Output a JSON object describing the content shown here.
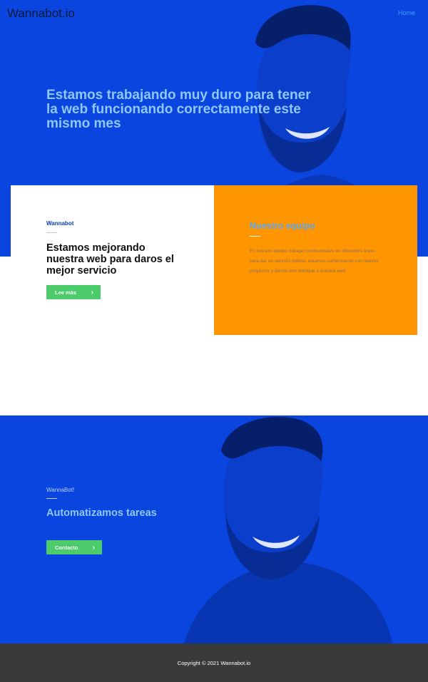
{
  "header": {
    "brand": "Wannabot.io",
    "menu_link": "Home"
  },
  "hero": {
    "title": "Estamos trabajando muy duro para tener la web funcionando correctamente este mismo mes"
  },
  "intro_card": {
    "kicker": "Wannabot",
    "heading": "Estamos mejorando nuestra web para daros el mejor servicio",
    "button_label": "Lee más"
  },
  "team_card": {
    "title": "Nuestro equipo",
    "text": "En nuestro equipo trabajan profesionales en diferentes áreas para dar un servicio óptimo, estamos comenzando con nuevos proyectos y dando otro enfoque a nuestra web."
  },
  "cta": {
    "kicker": "WannaBot!",
    "title": "Automatizamos tareas",
    "button_label": "Contacto"
  },
  "footer": {
    "copyright": "Copyright © 2021 Wannabot.io"
  },
  "colors": {
    "brand_blue": "#0a45e0",
    "orange": "#ff9500",
    "button_green": "#4ccb6b",
    "footer_gray": "#3a3a3a"
  },
  "icons": {
    "button_chevron": "chevron-right-icon"
  }
}
